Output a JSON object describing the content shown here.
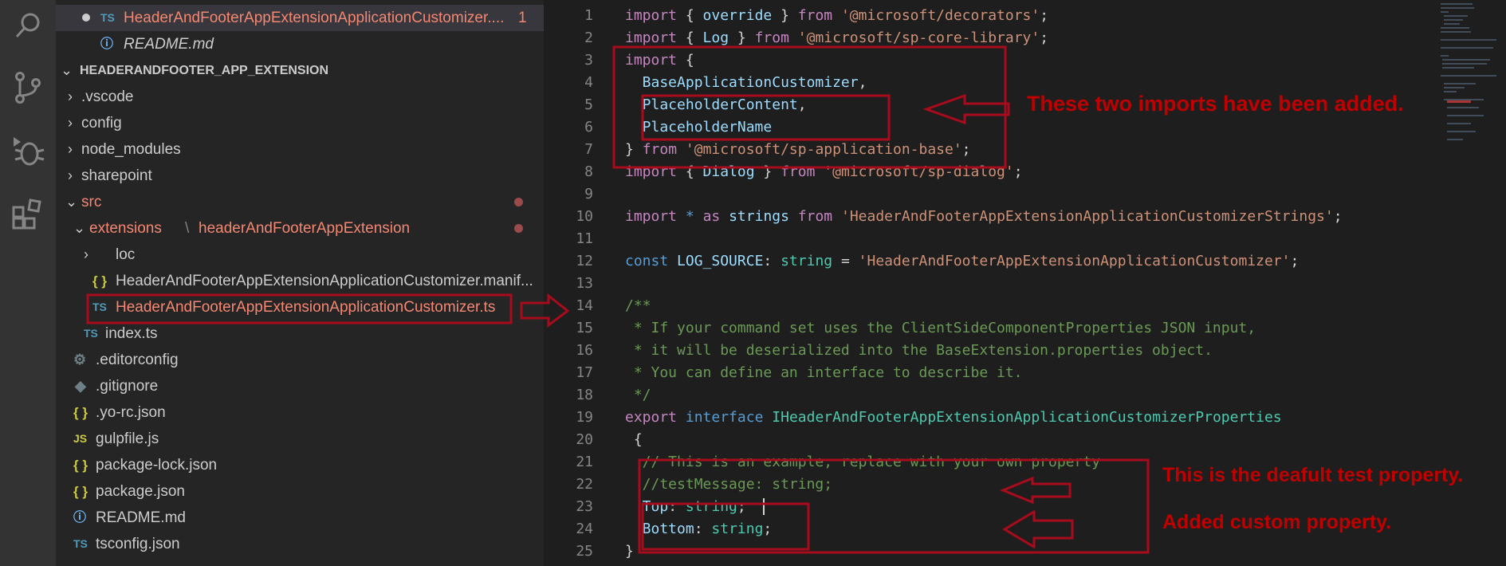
{
  "activity_bar": {
    "icons": [
      "search-icon",
      "source-control-icon",
      "debug-icon",
      "extensions-icon"
    ]
  },
  "explorer": {
    "open_editors": [
      {
        "icon": "TS",
        "name": "HeaderAndFooterAppExtensionApplicationCustomizer....",
        "badge": "1"
      },
      {
        "icon": "ⓘ",
        "name": "README.md"
      }
    ],
    "project_title": "HEADERANDFOOTER_APP_EXTENSION",
    "tree": [
      {
        "type": "folder",
        "name": ".vscode"
      },
      {
        "type": "folder",
        "name": "config"
      },
      {
        "type": "folder",
        "name": "node_modules"
      },
      {
        "type": "folder",
        "name": "sharepoint"
      },
      {
        "type": "folder-open",
        "name": "src"
      },
      {
        "type": "folder-open",
        "name": "extensions",
        "sub": "headerAndFooterAppExtension"
      },
      {
        "type": "folder",
        "name": "loc"
      },
      {
        "type": "file",
        "icon": "{ }",
        "name": "HeaderAndFooterAppExtensionApplicationCustomizer.manif..."
      },
      {
        "type": "file",
        "icon": "TS",
        "name": "HeaderAndFooterAppExtensionApplicationCustomizer.ts"
      },
      {
        "type": "file",
        "icon": "TS",
        "name": "index.ts"
      },
      {
        "type": "file",
        "icon": "⚙",
        "name": ".editorconfig"
      },
      {
        "type": "file",
        "icon": "◆",
        "name": ".gitignore"
      },
      {
        "type": "file",
        "icon": "{ }",
        "name": ".yo-rc.json"
      },
      {
        "type": "file",
        "icon": "JS",
        "name": "gulpfile.js"
      },
      {
        "type": "file",
        "icon": "{ }",
        "name": "package-lock.json"
      },
      {
        "type": "file",
        "icon": "{ }",
        "name": "package.json"
      },
      {
        "type": "file",
        "icon": "ⓘ",
        "name": "README.md"
      },
      {
        "type": "file",
        "icon": "TS",
        "name": "tsconfig.json"
      }
    ]
  },
  "editor": {
    "line_numbers": [
      "1",
      "2",
      "3",
      "4",
      "5",
      "6",
      "7",
      "8",
      "9",
      "10",
      "11",
      "12",
      "13",
      "14",
      "15",
      "16",
      "17",
      "18",
      "19",
      "20",
      "21",
      "22",
      "23",
      "24",
      "25"
    ],
    "lines": [
      "import { override } from '@microsoft/decorators';",
      "import { Log } from '@microsoft/sp-core-library';",
      "import {",
      "  BaseApplicationCustomizer,",
      "  PlaceholderContent,",
      "  PlaceholderName",
      "} from '@microsoft/sp-application-base';",
      "import { Dialog } from '@microsoft/sp-dialog';",
      "",
      "import * as strings from 'HeaderAndFooterAppExtensionApplicationCustomizerStrings';",
      "",
      "const LOG_SOURCE: string = 'HeaderAndFooterAppExtensionApplicationCustomizer';",
      "",
      "/**",
      " * If your command set uses the ClientSideComponentProperties JSON input,",
      " * it will be deserialized into the BaseExtension.properties object.",
      " * You can define an interface to describe it.",
      " */",
      "export interface IHeaderAndFooterAppExtensionApplicationCustomizerProperties",
      " {",
      "  // This is an example; replace with your own property",
      "  //testMessage: string;",
      "  Top: string;",
      "  Bottom: string;",
      "}"
    ]
  },
  "annotations": {
    "imports_added": "These two imports have been added.",
    "default_property": "This is the deafult test property.",
    "custom_property": "Added custom property."
  },
  "colors": {
    "annotation": "#c00000",
    "box": "#a80b1c",
    "modified": "#f48771"
  }
}
